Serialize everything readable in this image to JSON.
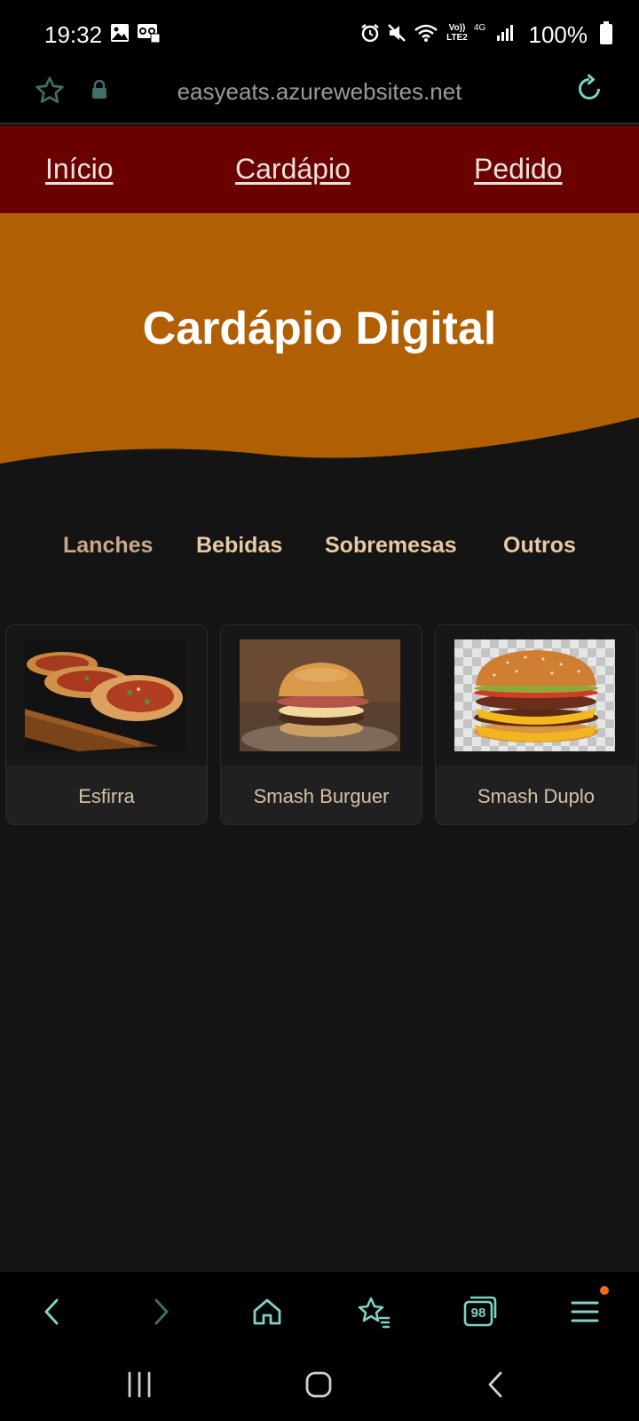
{
  "status_bar": {
    "time": "19:32",
    "network_label_top": "Vo))",
    "network_label_bottom": "LTE2",
    "network_type": "4G",
    "battery": "100%",
    "icons": [
      "image-icon",
      "voicemail-icon",
      "alarm-icon",
      "mute-icon",
      "wifi-icon",
      "signal-icon",
      "battery-icon"
    ]
  },
  "browser": {
    "url": "easyeats.azurewebsites.net",
    "tab_count": "98",
    "accent_color": "#7fd1c6"
  },
  "nav": {
    "items": [
      {
        "label": "Início"
      },
      {
        "label": "Cardápio"
      },
      {
        "label": "Pedido"
      }
    ],
    "background": "#6b0000"
  },
  "hero": {
    "title": "Cardápio Digital",
    "background": "#b06003"
  },
  "categories": [
    {
      "label": "Lanches",
      "active": true
    },
    {
      "label": "Bebidas",
      "active": false
    },
    {
      "label": "Sobremesas",
      "active": false
    },
    {
      "label": "Outros",
      "active": false
    }
  ],
  "products": [
    {
      "name": "Esfirra",
      "image": "esfirra-photo"
    },
    {
      "name": "Smash Burguer",
      "image": "smash-burger-photo"
    },
    {
      "name": "Smash Duplo",
      "image": "double-burger-photo"
    }
  ]
}
